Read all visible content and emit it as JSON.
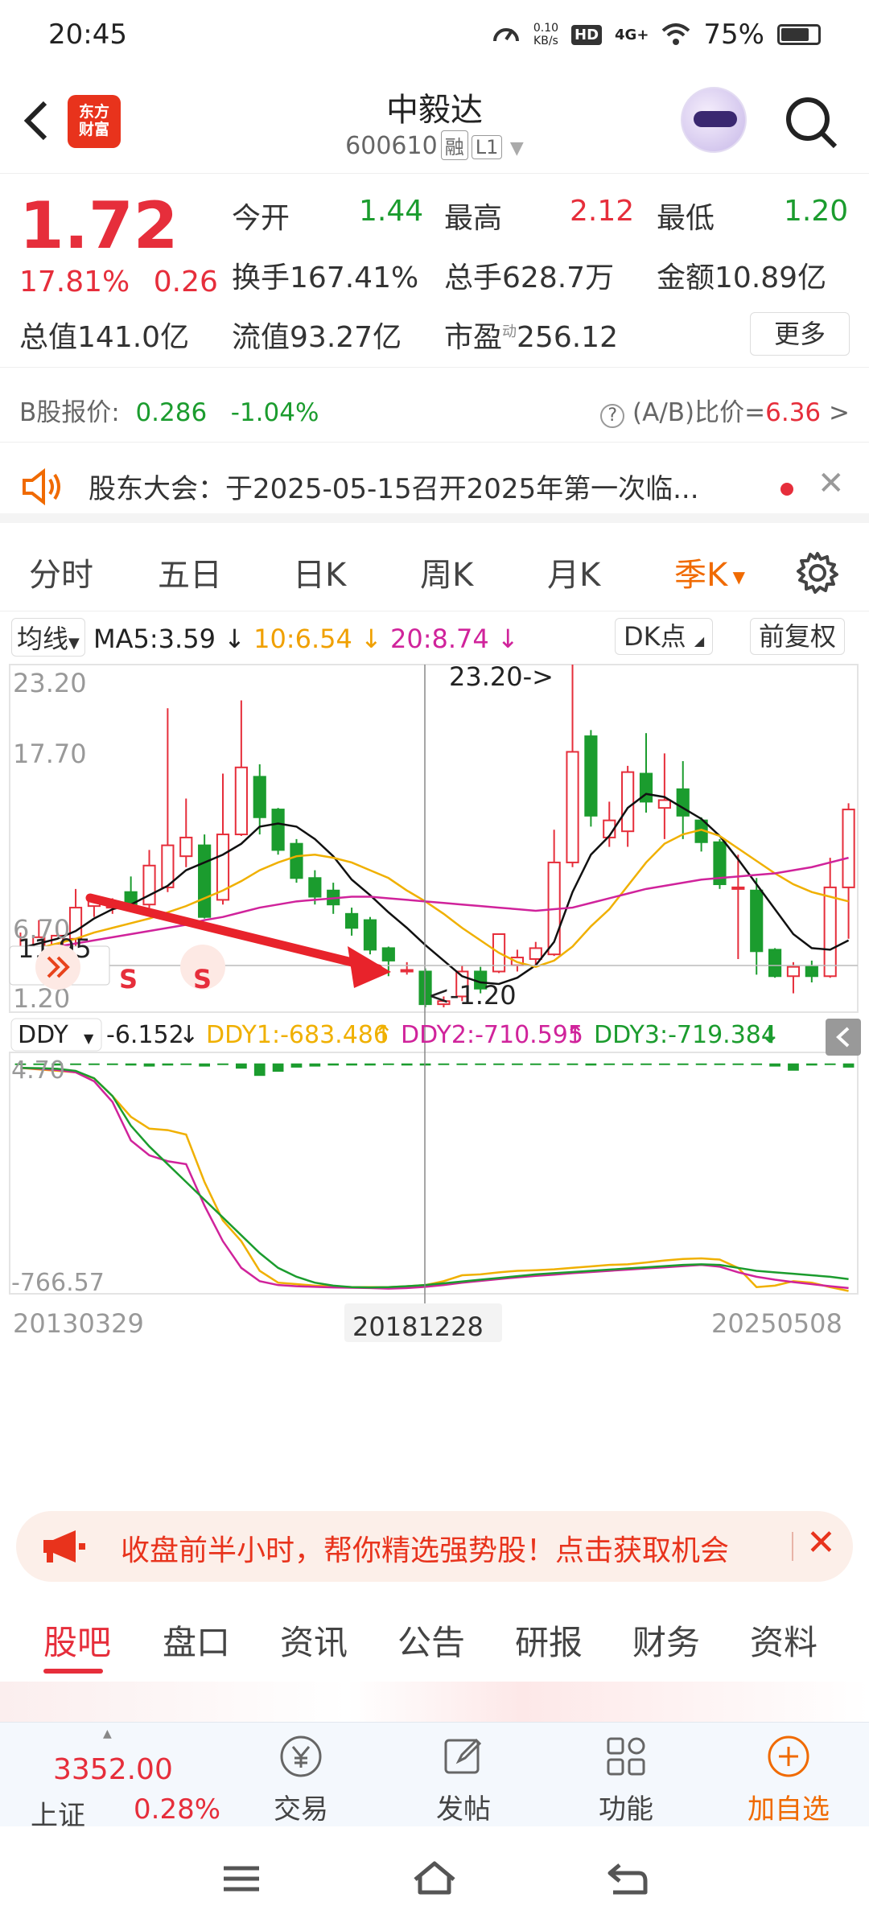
{
  "status_bar": {
    "time": "20:45",
    "net_speed_value": "0.10",
    "net_speed_unit": "KB/s",
    "hd": "HD",
    "signal": "4G+",
    "battery": "75%"
  },
  "header": {
    "logo_line1": "东方",
    "logo_line2": "财富",
    "stock_name": "中毅达",
    "stock_code": "600610",
    "tag_margin": "融",
    "tag_level": "L1"
  },
  "quote": {
    "price": "1.72",
    "change_pct": "17.81%",
    "change_amt": "0.26",
    "open_label": "今开",
    "open": "1.44",
    "high_label": "最高",
    "high": "2.12",
    "low_label": "最低",
    "low": "1.20",
    "turnover_label": "换手",
    "turnover": "167.41%",
    "volume_label": "总手",
    "volume": "628.7万",
    "amount_label": "金额",
    "amount": "10.89亿",
    "mktcap_label": "总值",
    "mktcap": "141.0亿",
    "float_label": "流值",
    "float": "93.27亿",
    "pe_label": "市盈",
    "pe_sup": "动",
    "pe": "256.12",
    "more": "更多"
  },
  "b_share": {
    "label": "B股报价:",
    "price": "0.286",
    "pct": "-1.04%",
    "ratio_label": "(A/B)比价=",
    "ratio": "6.36",
    "help": "?",
    "arrow": ">"
  },
  "ticker": {
    "text": "股东大会：于2025-05-15召开2025年第一次临..."
  },
  "tabs": [
    "分时",
    "五日",
    "日K",
    "周K",
    "月K",
    "季K",
    "设置"
  ],
  "active_tab": "季K",
  "chart_controls": {
    "ma_select": "均线",
    "ma5": "MA5:3.59",
    "ma10": "10:6.54",
    "ma20": "20:8.74",
    "dk": "DK点",
    "fq": "前复权"
  },
  "indicator_controls": {
    "name": "DDY",
    "ddy": "-6.152",
    "ddy1": "DDY1:-683.486",
    "ddy2": "DDY2:-710.595",
    "ddy3": "DDY3:-719.384"
  },
  "chart_labels": {
    "y_top": "23.20",
    "y_mid": "17.70",
    "y_cross": "11.95",
    "y_low": "6.70",
    "y_bottom": "1.20",
    "max_label": "23.20->",
    "min_label": "<-1.20",
    "ind_top": "4.70",
    "ind_bottom": "-766.57",
    "date_left": "20130329",
    "date_mid": "20181228",
    "date_right": "20250508",
    "signal_s1": "S",
    "signal_s2": "S"
  },
  "colors": {
    "up": "#e62e3b",
    "down": "#1b9c2e",
    "ma5": "#111111",
    "ma10": "#f0b000",
    "ma20": "#d0239b",
    "accent": "#f06a00"
  },
  "chart_data": {
    "type": "candlestick",
    "period": "quarterly",
    "ylim": [
      1.2,
      23.2
    ],
    "indicator_ylim": [
      -766.57,
      4.7
    ],
    "date_range": [
      "20130329",
      "20250508"
    ],
    "candles": [
      {
        "o": 4.3,
        "c": 5.0,
        "h": 6.0,
        "l": 3.8
      },
      {
        "o": 4.8,
        "c": 5.7,
        "h": 6.8,
        "l": 4.2
      },
      {
        "o": 5.2,
        "c": 5.8,
        "h": 6.5,
        "l": 4.9
      },
      {
        "o": 5.6,
        "c": 7.6,
        "h": 8.8,
        "l": 4.6
      },
      {
        "o": 7.7,
        "c": 8.0,
        "h": 8.4,
        "l": 7.0
      },
      {
        "o": 7.6,
        "c": 7.7,
        "h": 8.2,
        "l": 7.2
      },
      {
        "o": 8.6,
        "c": 7.8,
        "h": 9.6,
        "l": 7.6
      },
      {
        "o": 7.8,
        "c": 10.3,
        "h": 11.3,
        "l": 7.5
      },
      {
        "o": 8.9,
        "c": 11.6,
        "h": 20.4,
        "l": 8.6
      },
      {
        "o": 10.9,
        "c": 12.1,
        "h": 14.6,
        "l": 10.2
      },
      {
        "o": 11.6,
        "c": 7.0,
        "h": 12.3,
        "l": 6.9
      },
      {
        "o": 8.1,
        "c": 12.3,
        "h": 16.2,
        "l": 7.8
      },
      {
        "o": 12.3,
        "c": 16.6,
        "h": 20.9,
        "l": 12.2
      },
      {
        "o": 16.0,
        "c": 13.4,
        "h": 16.8,
        "l": 12.3
      },
      {
        "o": 13.9,
        "c": 11.3,
        "h": 14.0,
        "l": 11.0
      },
      {
        "o": 11.7,
        "c": 9.5,
        "h": 12.0,
        "l": 9.2
      },
      {
        "o": 9.5,
        "c": 8.3,
        "h": 10.0,
        "l": 7.8
      },
      {
        "o": 8.7,
        "c": 7.8,
        "h": 9.2,
        "l": 7.2
      },
      {
        "o": 7.2,
        "c": 6.3,
        "h": 7.6,
        "l": 5.8
      },
      {
        "o": 6.8,
        "c": 4.9,
        "h": 7.0,
        "l": 4.6
      },
      {
        "o": 5.0,
        "c": 4.2,
        "h": 5.1,
        "l": 3.2
      },
      {
        "o": 3.5,
        "c": 3.6,
        "h": 4.1,
        "l": 3.3
      },
      {
        "o": 3.5,
        "c": 1.4,
        "h": 3.7,
        "l": 1.2
      },
      {
        "o": 1.4,
        "c": 1.6,
        "h": 1.9,
        "l": 1.2
      },
      {
        "o": 1.9,
        "c": 3.5,
        "h": 3.9,
        "l": 1.6
      },
      {
        "o": 3.5,
        "c": 2.4,
        "h": 3.8,
        "l": 2.1
      },
      {
        "o": 3.5,
        "c": 5.9,
        "h": 5.9,
        "l": 3.4
      },
      {
        "o": 3.9,
        "c": 4.4,
        "h": 4.9,
        "l": 3.5
      },
      {
        "o": 4.3,
        "c": 5.0,
        "h": 5.4,
        "l": 3.8
      },
      {
        "o": 4.6,
        "c": 10.5,
        "h": 12.6,
        "l": 4.5
      },
      {
        "o": 10.5,
        "c": 17.6,
        "h": 23.2,
        "l": 10.2
      },
      {
        "o": 18.6,
        "c": 13.5,
        "h": 19.0,
        "l": 12.8
      },
      {
        "o": 12.1,
        "c": 13.2,
        "h": 14.4,
        "l": 11.5
      },
      {
        "o": 12.5,
        "c": 16.3,
        "h": 16.7,
        "l": 11.5
      },
      {
        "o": 16.2,
        "c": 14.4,
        "h": 18.8,
        "l": 13.7
      },
      {
        "o": 14.0,
        "c": 14.5,
        "h": 17.5,
        "l": 12.0
      },
      {
        "o": 15.2,
        "c": 13.5,
        "h": 17.0,
        "l": 12.0
      },
      {
        "o": 13.2,
        "c": 11.8,
        "h": 13.4,
        "l": 11.2
      },
      {
        "o": 11.8,
        "c": 9.1,
        "h": 12.0,
        "l": 8.8
      },
      {
        "o": 8.8,
        "c": 8.9,
        "h": 11.0,
        "l": 4.3
      },
      {
        "o": 8.7,
        "c": 4.8,
        "h": 9.5,
        "l": 3.3
      },
      {
        "o": 4.9,
        "c": 3.2,
        "h": 5.0,
        "l": 3.1
      },
      {
        "o": 3.2,
        "c": 3.8,
        "h": 4.1,
        "l": 2.1
      },
      {
        "o": 3.8,
        "c": 3.2,
        "h": 4.2,
        "l": 2.8
      },
      {
        "o": 3.2,
        "c": 8.9,
        "h": 10.8,
        "l": 3.1
      },
      {
        "o": 8.9,
        "c": 13.9,
        "h": 14.3,
        "l": 5.6
      }
    ],
    "ma5": [
      5.0,
      5.3,
      5.6,
      6.1,
      6.9,
      7.5,
      7.8,
      8.4,
      9.0,
      10.0,
      10.5,
      11.0,
      11.7,
      12.8,
      13.0,
      12.8,
      12.0,
      10.9,
      9.4,
      8.4,
      7.3,
      6.3,
      5.2,
      4.2,
      3.2,
      2.8,
      2.7,
      3.1,
      3.9,
      5.4,
      8.6,
      11.0,
      12.2,
      14.0,
      14.9,
      14.7,
      14.0,
      13.3,
      12.2,
      10.7,
      9.1,
      7.5,
      5.9,
      5.0,
      4.9,
      5.5
    ],
    "ma10": [
      4.8,
      5.0,
      5.3,
      5.6,
      6.0,
      6.3,
      6.6,
      6.9,
      7.3,
      7.7,
      8.2,
      8.7,
      9.3,
      10.0,
      10.5,
      10.9,
      11.0,
      10.8,
      10.5,
      10.0,
      9.5,
      8.7,
      8.0,
      7.2,
      6.3,
      5.5,
      4.7,
      4.1,
      3.8,
      4.2,
      5.1,
      6.4,
      7.5,
      9.0,
      10.5,
      11.7,
      12.3,
      12.6,
      12.2,
      11.4,
      10.6,
      9.8,
      9.1,
      8.6,
      8.3,
      8.0
    ],
    "ma20": [
      4.7,
      4.9,
      5.1,
      5.3,
      5.5,
      5.7,
      5.9,
      6.1,
      6.3,
      6.5,
      6.8,
      7.0,
      7.3,
      7.6,
      7.8,
      8.0,
      8.1,
      8.2,
      8.3,
      8.3,
      8.2,
      8.1,
      8.0,
      7.9,
      7.8,
      7.7,
      7.6,
      7.5,
      7.4,
      7.5,
      7.6,
      7.9,
      8.2,
      8.5,
      8.8,
      9.0,
      9.2,
      9.4,
      9.5,
      9.6,
      9.7,
      9.8,
      10.0,
      10.2,
      10.5,
      10.8
    ],
    "ddy": [
      0,
      -1,
      -2,
      -1,
      0,
      -1,
      -2,
      -3,
      -2,
      -1,
      -3,
      -1,
      -5,
      -12,
      -8,
      -4,
      -3,
      -2,
      -2,
      -2,
      -1,
      -2,
      -2,
      -1,
      -1,
      0,
      -1,
      0,
      0,
      0,
      -1,
      -2,
      -1,
      -1,
      -1,
      -1,
      -1,
      -1,
      -1,
      -1,
      -1,
      -3,
      -7,
      -2,
      -1,
      -4
    ],
    "ddy1": [
      -15,
      -20,
      -25,
      -30,
      -50,
      -110,
      -180,
      -220,
      -225,
      -240,
      -400,
      -530,
      -600,
      -700,
      -740,
      -745,
      -750,
      -752,
      -755,
      -755,
      -755,
      -752,
      -748,
      -735,
      -715,
      -712,
      -705,
      -700,
      -698,
      -695,
      -690,
      -685,
      -680,
      -678,
      -672,
      -665,
      -660,
      -658,
      -662,
      -690,
      -755,
      -750,
      -735,
      -740,
      -755,
      -768
    ],
    "ddy2": [
      -15,
      -18,
      -22,
      -30,
      -60,
      -130,
      -260,
      -310,
      -330,
      -340,
      -480,
      -600,
      -690,
      -735,
      -748,
      -752,
      -754,
      -756,
      -757,
      -758,
      -760,
      -758,
      -754,
      -748,
      -740,
      -734,
      -728,
      -722,
      -717,
      -713,
      -708,
      -704,
      -700,
      -696,
      -692,
      -688,
      -684,
      -680,
      -686,
      -705,
      -720,
      -730,
      -738,
      -745,
      -752,
      -758
    ],
    "ddy3": [
      -15,
      -16,
      -18,
      -25,
      -50,
      -110,
      -210,
      -280,
      -340,
      -400,
      -460,
      -520,
      -580,
      -640,
      -690,
      -720,
      -740,
      -750,
      -755,
      -756,
      -755,
      -752,
      -748,
      -742,
      -736,
      -730,
      -724,
      -718,
      -712,
      -708,
      -704,
      -700,
      -696,
      -692,
      -688,
      -684,
      -680,
      -678,
      -680,
      -690,
      -700,
      -705,
      -710,
      -715,
      -720,
      -728
    ]
  },
  "promo": {
    "text": "收盘前半小时，帮你精选强势股！点击获取机会"
  },
  "sub_tabs": [
    "股吧",
    "盘口",
    "资讯",
    "公告",
    "研报",
    "财务",
    "资料"
  ],
  "bottom_nav": {
    "index_value": "3352.00",
    "index_name": "上证",
    "index_pct": "0.28%",
    "trade": "交易",
    "post": "发帖",
    "func": "功能",
    "add": "加自选"
  }
}
